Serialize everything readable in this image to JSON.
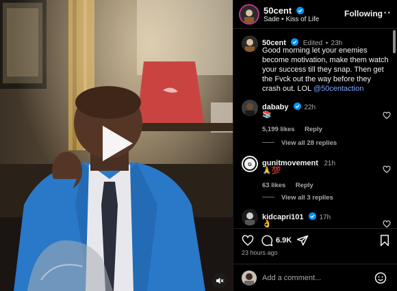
{
  "post": {
    "author": "50cent",
    "music_artist": "Sade",
    "music_separator": "•",
    "music_track": "Kiss of Life",
    "follow_label": "Following",
    "more_label": "···"
  },
  "caption": {
    "user": "50cent",
    "edited": "Edited",
    "separator": "•",
    "time": "23h",
    "text": "Good morning let your enemies become motivation, make them watch your success till they snap. Then get the Fvck out the way before they crash out. LOL",
    "mention": "@50centaction"
  },
  "comments": [
    {
      "user": "dababy",
      "verified": true,
      "time": "22h",
      "text": "📚",
      "likes": "5,199 likes",
      "reply": "Reply",
      "view_replies": "View all 28 replies"
    },
    {
      "user": "gunitmovement",
      "verified": false,
      "time": "21h",
      "text": "🙏💯",
      "likes": "63 likes",
      "reply": "Reply",
      "view_replies": "View all 3 replies"
    },
    {
      "user": "kidcapri101",
      "verified": true,
      "time": "17h",
      "text": "👌"
    }
  ],
  "actions": {
    "comment_count": "6.9K",
    "time_ago": "23 hours ago"
  },
  "add_comment": {
    "placeholder": "Add a comment..."
  },
  "icons": {
    "play": "play-icon",
    "mute": "muted-speaker-icon",
    "like": "heart-icon",
    "comment": "comment-bubble-icon",
    "share": "paper-plane-icon",
    "save": "bookmark-icon",
    "emoji": "smiley-icon"
  },
  "colors": {
    "verified_blue": "#0095f6",
    "jacket_blue": "#2a78c8",
    "background": "#000000",
    "secondary_text": "#a8a8a8",
    "mention": "#7aa5ff"
  }
}
